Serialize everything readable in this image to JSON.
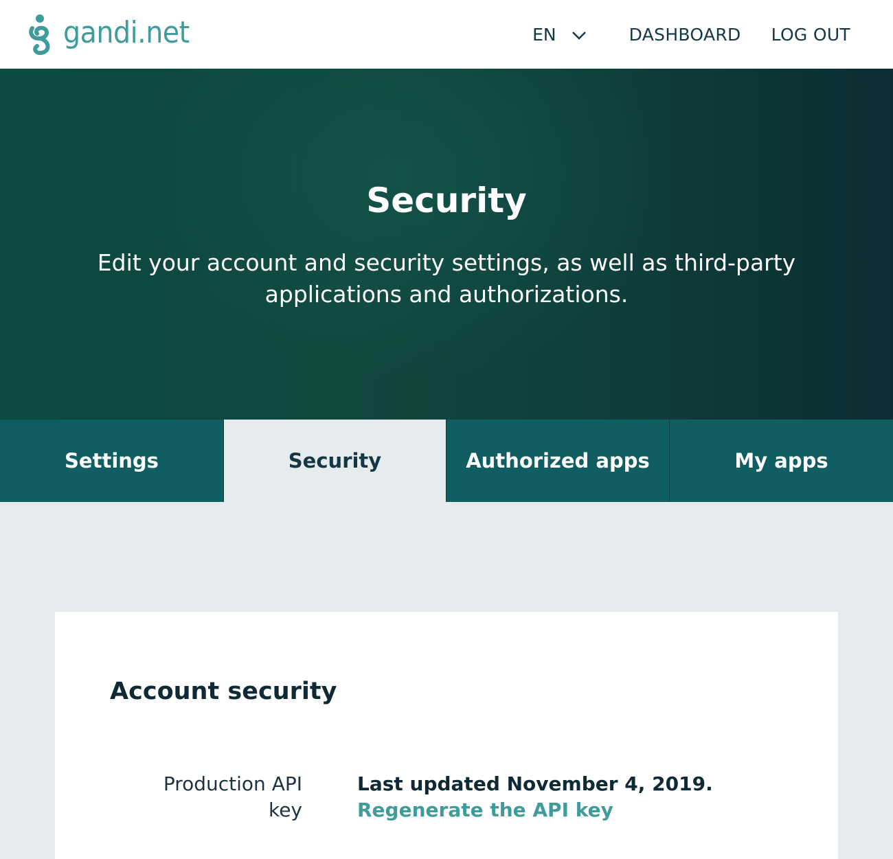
{
  "header": {
    "logo_text": "gandi.net",
    "language": "EN",
    "nav": {
      "dashboard": "DASHBOARD",
      "logout": "LOG OUT"
    }
  },
  "hero": {
    "title": "Security",
    "subtitle": "Edit your account and security settings, as well as third-party applications and authorizations."
  },
  "tabs": [
    {
      "label": "Settings",
      "active": false
    },
    {
      "label": "Security",
      "active": true
    },
    {
      "label": "Authorized apps",
      "active": false
    },
    {
      "label": "My apps",
      "active": false
    }
  ],
  "card": {
    "title": "Account security",
    "rows": [
      {
        "label": "Production API key",
        "updated": "Last updated November 4, 2019.",
        "action": "Regenerate the API key"
      }
    ]
  },
  "colors": {
    "brand": "#3f9c9a",
    "hero_bg": "#0d4a42",
    "tab_bg": "#115e62",
    "text_dark": "#143746",
    "page_bg": "#e6ebee"
  },
  "icons": {
    "logo": "gandi-logo-icon",
    "language_dropdown": "chevron-down-icon"
  }
}
